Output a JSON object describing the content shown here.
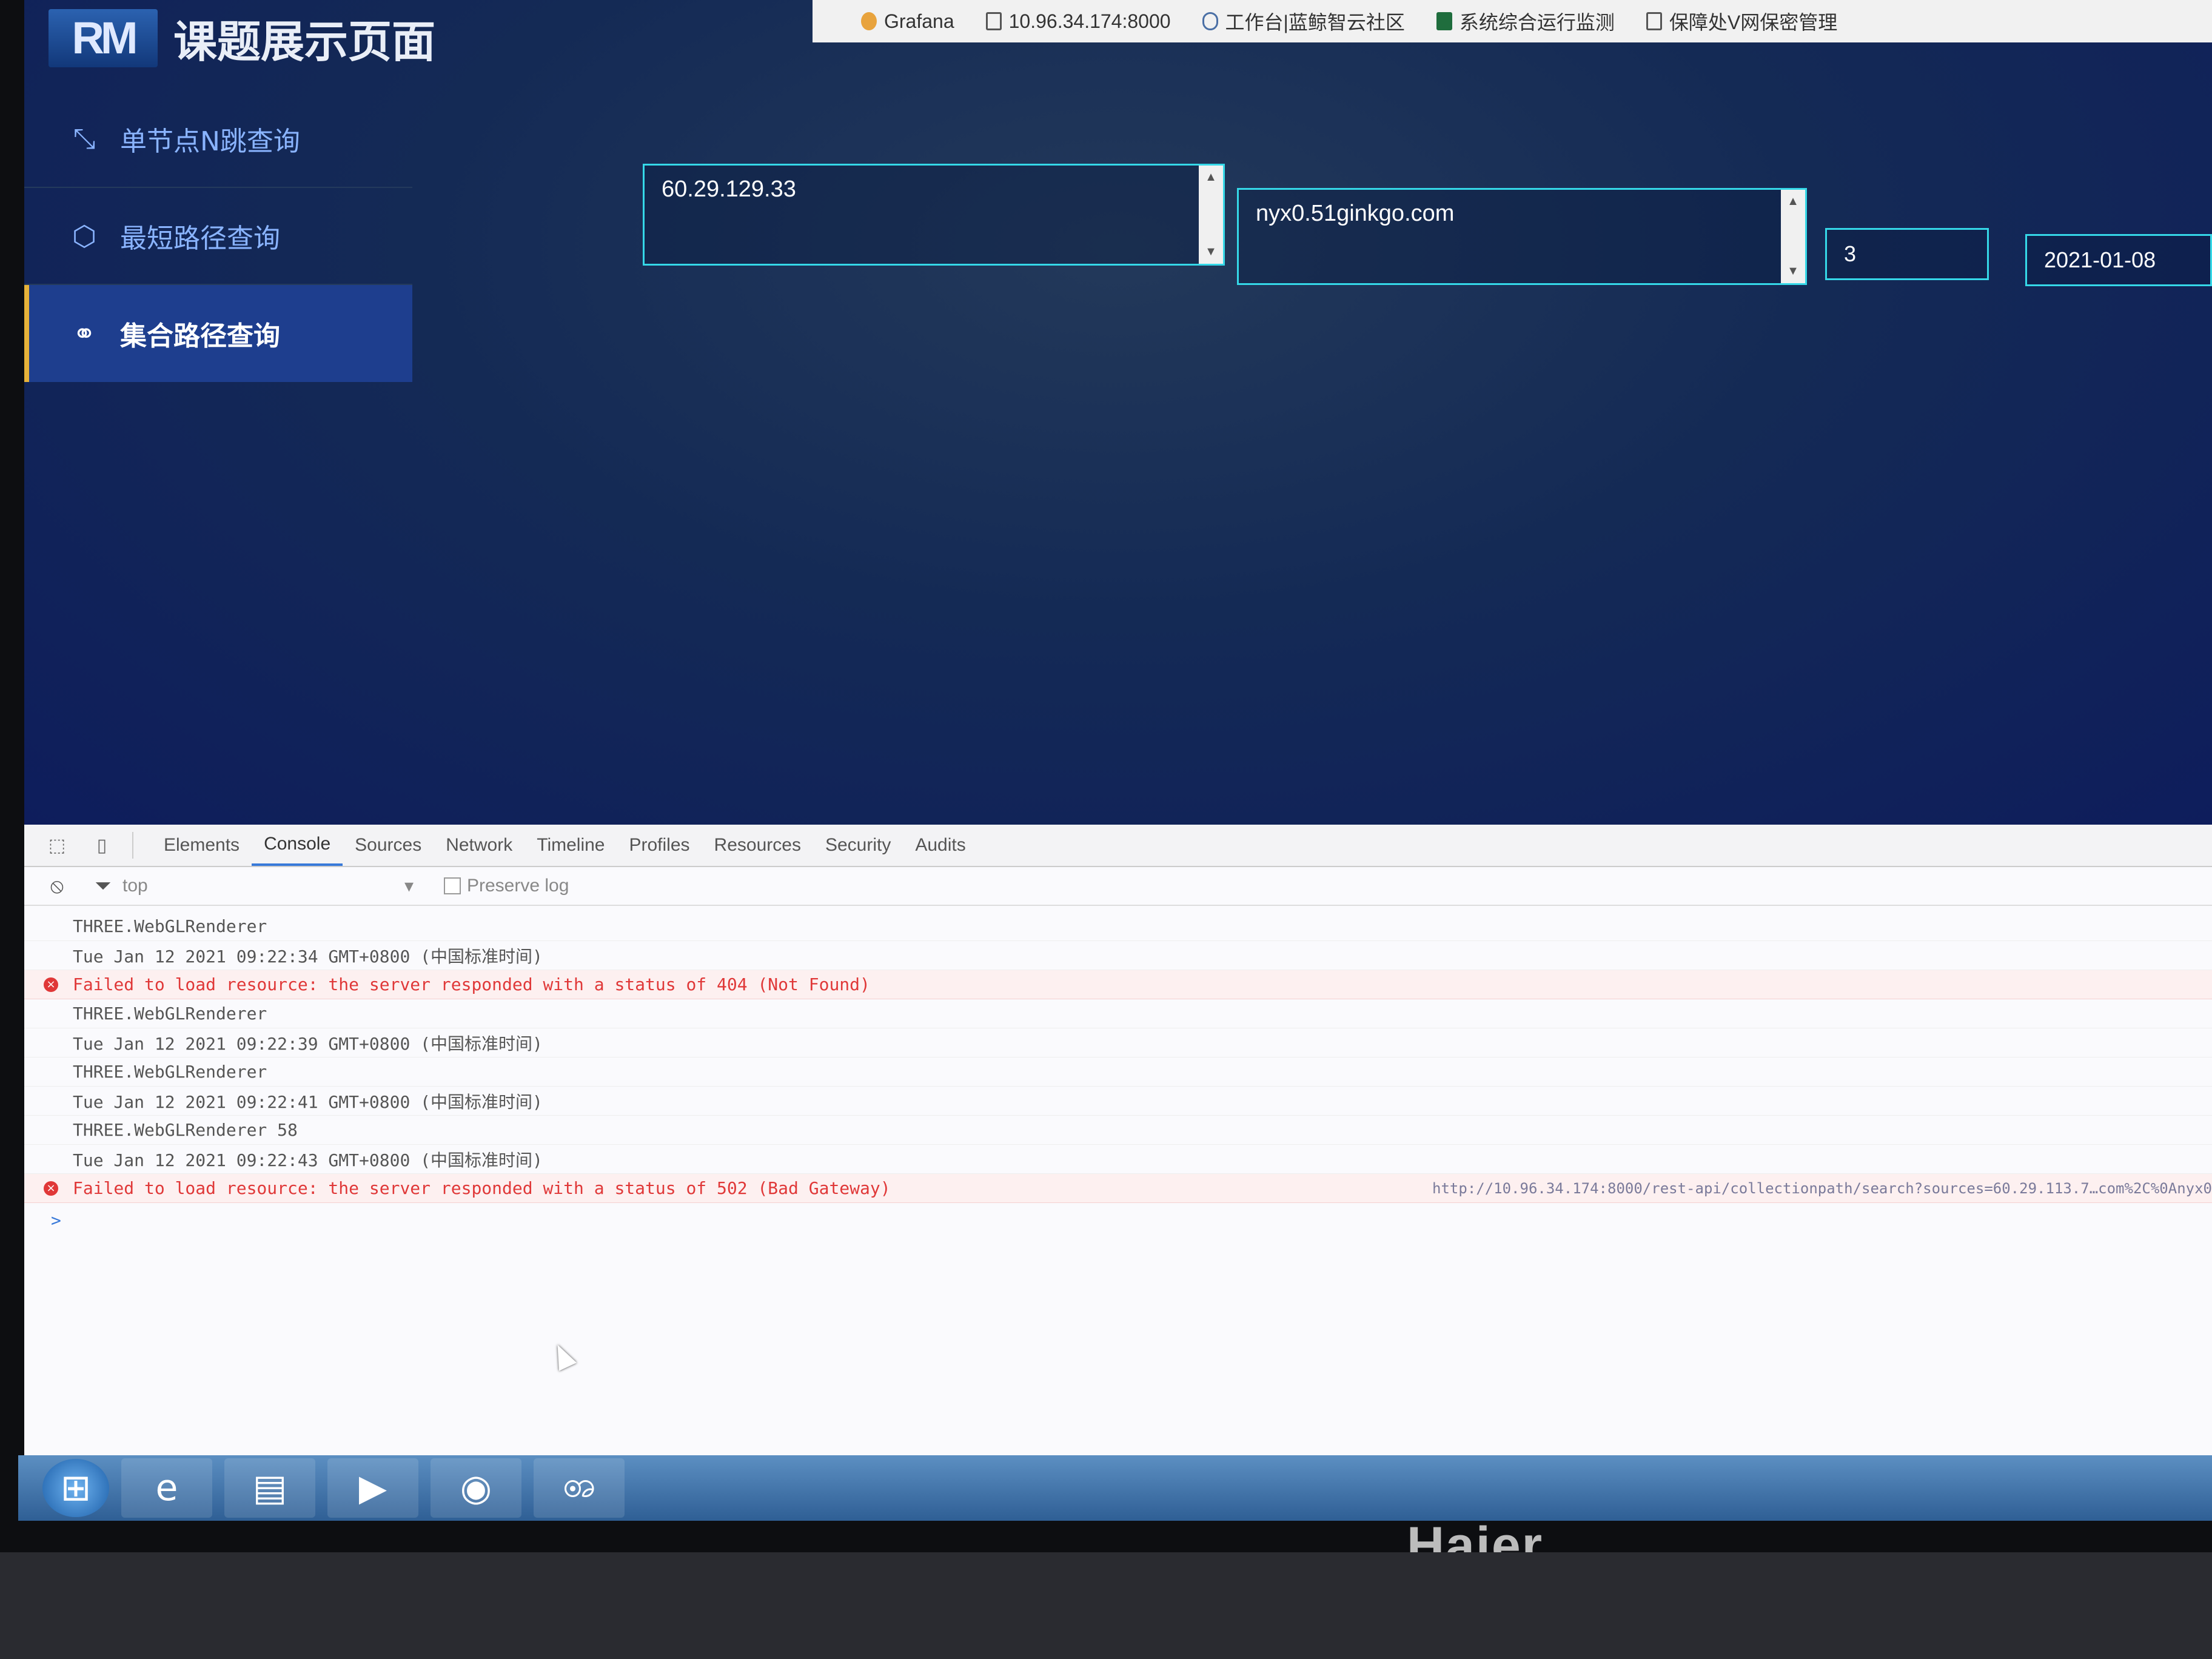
{
  "bookmarks": [
    {
      "label": "Grafana",
      "icon": "grafana-icon"
    },
    {
      "label": "10.96.34.174:8000",
      "icon": "page-icon"
    },
    {
      "label": "工作台|蓝鲸智云社区",
      "icon": "cloud-icon"
    },
    {
      "label": "系统综合运行监测",
      "icon": "monitor-icon"
    },
    {
      "label": "保障处V网保密管理",
      "icon": "page-icon"
    }
  ],
  "app": {
    "logo_text": "RM",
    "title": "课题展示页面"
  },
  "sidebar": {
    "items": [
      {
        "label": "单节点N跳查询",
        "icon": "hop-icon",
        "active": false
      },
      {
        "label": "最短路径查询",
        "icon": "cube-icon",
        "active": false
      },
      {
        "label": "集合路径查询",
        "icon": "collection-icon",
        "active": true
      }
    ]
  },
  "form": {
    "sources_value": "60.29.129.33",
    "targets_value": "nyx0.51ginkgo.com",
    "hops_value": "3",
    "date_value": "2021-01-08"
  },
  "devtools": {
    "tabs": [
      "Elements",
      "Console",
      "Sources",
      "Network",
      "Timeline",
      "Profiles",
      "Resources",
      "Security",
      "Audits"
    ],
    "active_tab": "Console",
    "context": "top",
    "preserve_log_label": "Preserve log",
    "console_lines": [
      {
        "text": "THREE.WebGLRenderer",
        "type": "log",
        "source": ""
      },
      {
        "text": "Tue Jan 12 2021 09:22:34 GMT+0800 (中国标准时间)",
        "type": "log",
        "source": ""
      },
      {
        "text": "Failed to load resource: the server responded with a status of 404 (Not Found)",
        "type": "error",
        "source": ""
      },
      {
        "text": "THREE.WebGLRenderer",
        "type": "log",
        "source": ""
      },
      {
        "text": "Tue Jan 12 2021 09:22:39 GMT+0800 (中国标准时间)",
        "type": "log",
        "source": ""
      },
      {
        "text": "THREE.WebGLRenderer",
        "type": "log",
        "source": ""
      },
      {
        "text": "Tue Jan 12 2021 09:22:41 GMT+0800 (中国标准时间)",
        "type": "log",
        "source": ""
      },
      {
        "text": "THREE.WebGLRenderer 58",
        "type": "log",
        "source": ""
      },
      {
        "text": "Tue Jan 12 2021 09:22:43 GMT+0800 (中国标准时间)",
        "type": "log",
        "source": ""
      },
      {
        "text": "Failed to load resource: the server responded with a status of 502 (Bad Gateway)",
        "type": "error",
        "source": "http://10.96.34.174:8000/rest-api/collectionpath/search?sources=60.29.113.7…com%2C%0Anyx0"
      }
    ],
    "prompt": ">"
  },
  "taskbar": {
    "items": [
      "start-orb-icon",
      "ie-icon",
      "explorer-icon",
      "media-player-icon",
      "chrome-icon",
      "swirl-app-icon"
    ]
  },
  "monitor_brand": "Haier"
}
